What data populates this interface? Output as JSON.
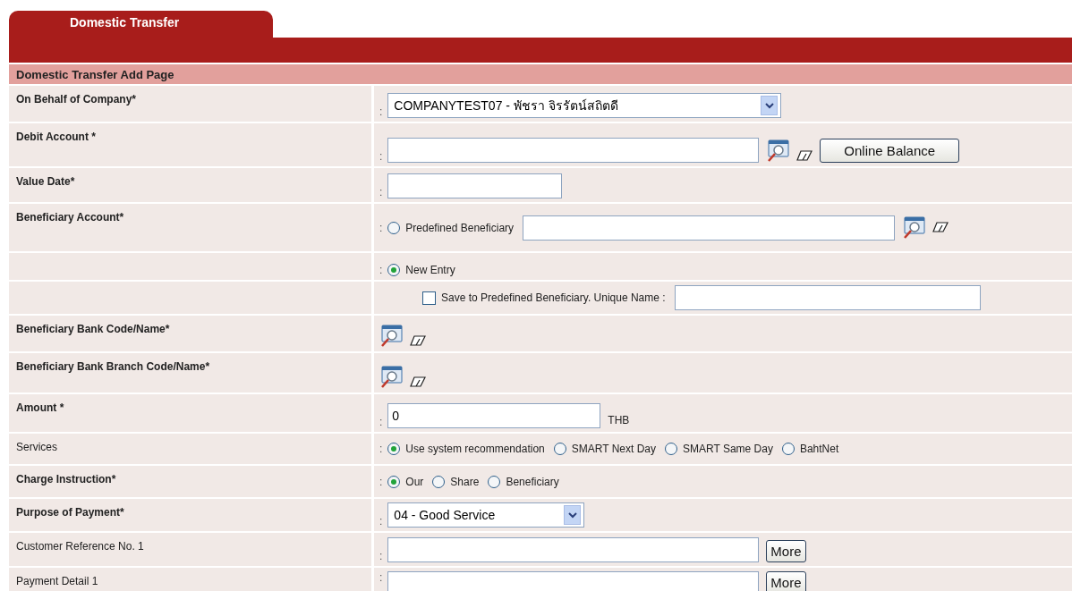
{
  "tab": {
    "label": "Domestic Transfer",
    "selected": true
  },
  "section_title": "Domestic Transfer Add Page",
  "rows": [
    {
      "label": "On Behalf of Company*",
      "bold": true,
      "separator": ":",
      "items": [
        {
          "kind": "select",
          "value": "COMPANYTEST07 - พัชรา จิรรัตน์สถิตดี"
        }
      ]
    },
    {
      "label": "Debit Account *",
      "bold": true,
      "separator": ":",
      "items": [
        {
          "kind": "input",
          "value": ""
        },
        {
          "kind": "lookup"
        },
        {
          "kind": "eraser"
        },
        {
          "kind": "button",
          "label": "Online Balance"
        }
      ]
    },
    {
      "label": "Value Date*",
      "bold": true,
      "separator": ":",
      "items": [
        {
          "kind": "input",
          "value": ""
        }
      ]
    },
    {
      "label": "Beneficiary Account*",
      "bold": true,
      "separator": ":",
      "items": [
        {
          "kind": "radio",
          "label": "Predefined Beneficiary",
          "selected": false
        },
        {
          "kind": "input",
          "value": ""
        },
        {
          "kind": "lookup"
        },
        {
          "kind": "eraser"
        }
      ]
    },
    {
      "separator": ":",
      "items": [
        {
          "kind": "radio",
          "label": "New Entry",
          "selected": true
        }
      ]
    },
    {
      "indent": true,
      "items": [
        {
          "kind": "checkbox",
          "label": "Save to Predefined Beneficiary.  Unique Name :",
          "checked": false
        },
        {
          "kind": "input",
          "value": ""
        }
      ]
    },
    {
      "label": "Beneficiary Bank Code/Name*",
      "bold": true,
      "items": [
        {
          "kind": "lookup"
        },
        {
          "kind": "eraser"
        }
      ]
    },
    {
      "label": "Beneficiary Bank Branch Code/Name*",
      "bold": true,
      "items": [
        {
          "kind": "lookup"
        },
        {
          "kind": "eraser"
        }
      ]
    },
    {
      "label": "Amount *",
      "bold": true,
      "separator": ":",
      "items": [
        {
          "kind": "input",
          "value": "0"
        },
        {
          "kind": "text",
          "label": "THB"
        }
      ]
    },
    {
      "label": "Services",
      "bold": false,
      "separator": ":",
      "items": [
        {
          "kind": "radio",
          "label": "Use system recommendation",
          "selected": true
        },
        {
          "kind": "radio",
          "label": "SMART Next Day",
          "selected": false
        },
        {
          "kind": "radio",
          "label": "SMART Same Day",
          "selected": false
        },
        {
          "kind": "radio",
          "label": "BahtNet",
          "selected": false
        }
      ]
    },
    {
      "label": "Charge Instruction*",
      "bold": true,
      "separator": ":",
      "items": [
        {
          "kind": "radio",
          "label": "Our",
          "selected": true
        },
        {
          "kind": "radio",
          "label": "Share",
          "selected": false
        },
        {
          "kind": "radio",
          "label": "Beneficiary",
          "selected": false
        }
      ]
    },
    {
      "label": "Purpose of Payment*",
      "bold": true,
      "separator": ":",
      "items": [
        {
          "kind": "select",
          "value": "04 - Good Service"
        }
      ]
    },
    {
      "label": "Customer Reference No. 1",
      "bold": false,
      "separator": ":",
      "items": [
        {
          "kind": "input",
          "value": ""
        },
        {
          "kind": "button",
          "label": "More"
        }
      ]
    },
    {
      "label": "Payment Detail 1",
      "bold": false,
      "separator": ":",
      "items": [
        {
          "kind": "input",
          "value": ""
        },
        {
          "kind": "button",
          "label": "More"
        }
      ]
    }
  ]
}
